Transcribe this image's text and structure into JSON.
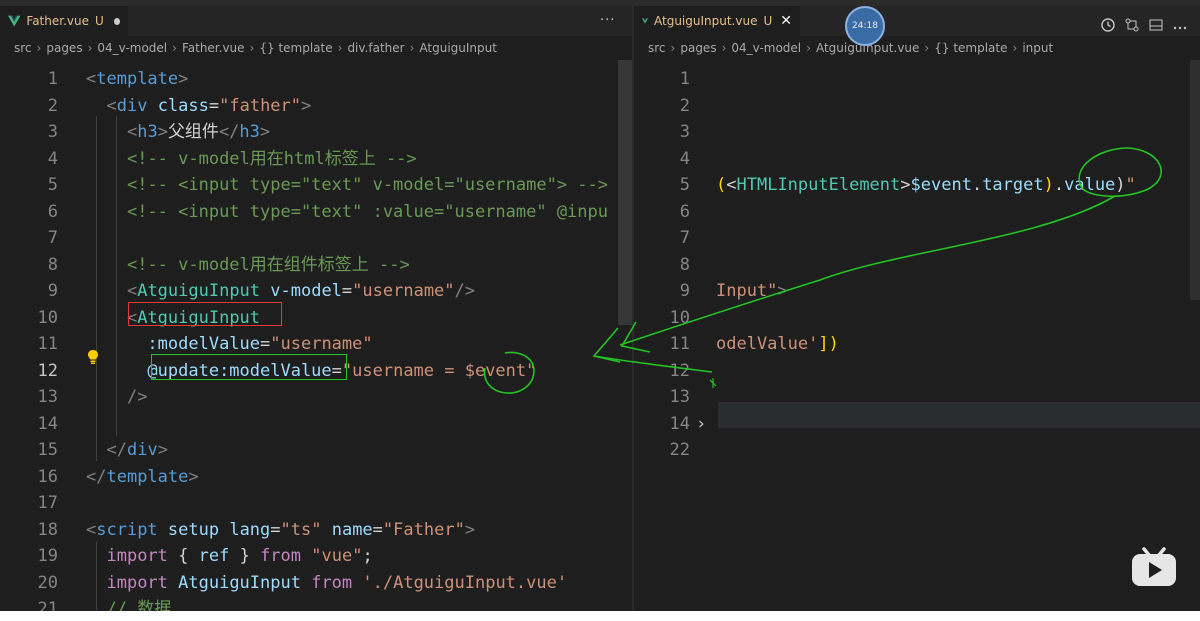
{
  "left_pane": {
    "tab": {
      "name": "Father.vue",
      "status": "U"
    },
    "more": "···",
    "breadcrumb": [
      "src",
      "pages",
      "04_v-model",
      "Father.vue",
      "{} template",
      "div.father",
      "AtguiguInput"
    ],
    "lines": [
      {
        "n": "1",
        "segs": [
          [
            "<",
            "t-pun"
          ],
          [
            "template",
            "t-tag"
          ],
          [
            ">",
            "t-pun"
          ]
        ]
      },
      {
        "n": "2",
        "segs": [
          [
            "  ",
            "t-txt"
          ],
          [
            "<",
            "t-pun"
          ],
          [
            "div ",
            "t-tag"
          ],
          [
            "class",
            "t-attr"
          ],
          [
            "=",
            "t-txt"
          ],
          [
            "\"father\"",
            "t-str"
          ],
          [
            ">",
            "t-pun"
          ]
        ]
      },
      {
        "n": "3",
        "segs": [
          [
            "    ",
            "t-txt"
          ],
          [
            "<",
            "t-pun"
          ],
          [
            "h3",
            "t-tag"
          ],
          [
            ">",
            "t-pun"
          ],
          [
            "父组件",
            "t-txt"
          ],
          [
            "</",
            "t-pun"
          ],
          [
            "h3",
            "t-tag"
          ],
          [
            ">",
            "t-pun"
          ]
        ]
      },
      {
        "n": "4",
        "segs": [
          [
            "    ",
            "t-txt"
          ],
          [
            "<!-- v-model用在html标签上 -->",
            "t-com"
          ]
        ]
      },
      {
        "n": "5",
        "segs": [
          [
            "    ",
            "t-txt"
          ],
          [
            "<!-- <input type=\"text\" v-model=\"username\"> -->",
            "t-com"
          ]
        ]
      },
      {
        "n": "6",
        "segs": [
          [
            "    ",
            "t-txt"
          ],
          [
            "<!-- <input type=\"text\" :value=\"username\" @inpu",
            "t-com"
          ]
        ]
      },
      {
        "n": "7",
        "segs": []
      },
      {
        "n": "8",
        "segs": [
          [
            "    ",
            "t-txt"
          ],
          [
            "<!-- v-model用在组件标签上 -->",
            "t-com"
          ]
        ]
      },
      {
        "n": "9",
        "segs": [
          [
            "    ",
            "t-txt"
          ],
          [
            "<",
            "t-pun"
          ],
          [
            "AtguiguInput ",
            "t-comp"
          ],
          [
            "v-model",
            "t-attr"
          ],
          [
            "=",
            "t-txt"
          ],
          [
            "\"username\"",
            "t-str"
          ],
          [
            "/>",
            "t-pun"
          ]
        ]
      },
      {
        "n": "10",
        "segs": [
          [
            "    ",
            "t-txt"
          ],
          [
            "<",
            "t-pun"
          ],
          [
            "AtguiguInput",
            "t-comp"
          ]
        ]
      },
      {
        "n": "11",
        "segs": [
          [
            "      ",
            "t-txt"
          ],
          [
            ":modelValue",
            "t-attr"
          ],
          [
            "=",
            "t-txt"
          ],
          [
            "\"username\"",
            "t-str"
          ]
        ]
      },
      {
        "n": "12",
        "segs": [
          [
            "      ",
            "t-txt"
          ],
          [
            "@update:modelValue",
            "t-attr"
          ],
          [
            "=",
            "t-txt"
          ],
          [
            "\"username = $event\"",
            "t-str"
          ]
        ]
      },
      {
        "n": "13",
        "segs": [
          [
            "    ",
            "t-txt"
          ],
          [
            "/>",
            "t-pun"
          ]
        ]
      },
      {
        "n": "14",
        "segs": []
      },
      {
        "n": "15",
        "segs": [
          [
            "  ",
            "t-txt"
          ],
          [
            "</",
            "t-pun"
          ],
          [
            "div",
            "t-tag"
          ],
          [
            ">",
            "t-pun"
          ]
        ]
      },
      {
        "n": "16",
        "segs": [
          [
            "</",
            "t-pun"
          ],
          [
            "template",
            "t-tag"
          ],
          [
            ">",
            "t-pun"
          ]
        ]
      },
      {
        "n": "17",
        "segs": []
      },
      {
        "n": "18",
        "segs": [
          [
            "<",
            "t-pun"
          ],
          [
            "script ",
            "t-tag"
          ],
          [
            "setup ",
            "t-attr"
          ],
          [
            "lang",
            "t-attr"
          ],
          [
            "=",
            "t-txt"
          ],
          [
            "\"ts\" ",
            "t-str"
          ],
          [
            "name",
            "t-attr"
          ],
          [
            "=",
            "t-txt"
          ],
          [
            "\"Father\"",
            "t-str"
          ],
          [
            ">",
            "t-pun"
          ]
        ]
      },
      {
        "n": "19",
        "segs": [
          [
            "  ",
            "t-txt"
          ],
          [
            "import ",
            "t-kw"
          ],
          [
            "{ ",
            "t-txt"
          ],
          [
            "ref ",
            "t-var"
          ],
          [
            "} ",
            "t-txt"
          ],
          [
            "from ",
            "t-kw"
          ],
          [
            "\"vue\"",
            "t-str"
          ],
          [
            ";",
            "t-txt"
          ]
        ]
      },
      {
        "n": "20",
        "segs": [
          [
            "  ",
            "t-txt"
          ],
          [
            "import ",
            "t-kw"
          ],
          [
            "AtguiguInput ",
            "t-var"
          ],
          [
            "from ",
            "t-kw"
          ],
          [
            "'./AtguiguInput.vue'",
            "t-str"
          ]
        ]
      },
      {
        "n": "21",
        "segs": [
          [
            "  ",
            "t-txt"
          ],
          [
            "// 数据",
            "t-com"
          ]
        ]
      }
    ],
    "active_line": "12"
  },
  "right_pane": {
    "tab": {
      "name": "AtguiguInput.vue",
      "status": "U",
      "close": "✕"
    },
    "breadcrumb": [
      "src",
      "pages",
      "04_v-model",
      "AtguiguInput.vue",
      "{} template",
      "input"
    ],
    "lines": [
      {
        "n": "1",
        "segs": []
      },
      {
        "n": "2",
        "segs": []
      },
      {
        "n": "3",
        "segs": []
      },
      {
        "n": "4",
        "segs": []
      },
      {
        "n": "5",
        "segs": [
          [
            "(",
            "t-brk"
          ],
          [
            "<",
            "t-txt"
          ],
          [
            "HTMLInputElement",
            "t-comp"
          ],
          [
            ">",
            "t-txt"
          ],
          [
            "$event",
            "t-var"
          ],
          [
            ".",
            "t-txt"
          ],
          [
            "target",
            "t-var"
          ],
          [
            ")",
            "t-brk"
          ],
          [
            ".",
            "t-txt"
          ],
          [
            "value",
            "t-var"
          ],
          [
            ")",
            "t-txt"
          ],
          [
            "\"",
            "t-str"
          ]
        ]
      },
      {
        "n": "6",
        "segs": []
      },
      {
        "n": "7",
        "segs": []
      },
      {
        "n": "8",
        "segs": []
      },
      {
        "n": "9",
        "segs": [
          [
            "Input\"",
            "t-str"
          ],
          [
            ">",
            "t-pun"
          ]
        ]
      },
      {
        "n": "10",
        "segs": []
      },
      {
        "n": "11",
        "segs": [
          [
            "odelValue'",
            "t-str"
          ],
          [
            "])",
            "t-brk"
          ]
        ]
      },
      {
        "n": "12",
        "segs": []
      },
      {
        "n": "13",
        "segs": []
      },
      {
        "n": "14",
        "segs": [],
        "fold": "›"
      },
      {
        "n": "22",
        "segs": []
      }
    ]
  },
  "timer": "24:18",
  "colors": {
    "annotation_red": "#e53935",
    "annotation_green": "#22c322",
    "accent": "#4ec9b0"
  }
}
